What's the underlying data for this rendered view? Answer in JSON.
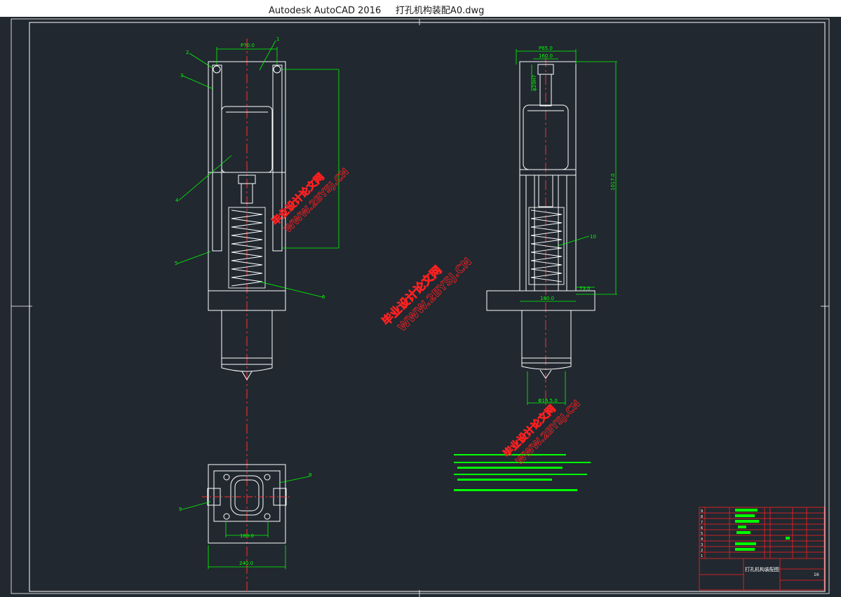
{
  "window": {
    "app_name": "Autodesk AutoCAD 2016",
    "file_name": "打孔机构装配A0.dwg"
  },
  "drawing": {
    "front_view": {
      "dim_top": "P70.0",
      "dim_bottom_plan": "240.0",
      "dim_plan_inner": "180.0",
      "leaders": [
        "1",
        "2",
        "3",
        "4",
        "5",
        "6",
        "8",
        "9"
      ]
    },
    "side_view": {
      "dim_top_outer": "P65.0",
      "dim_top_inner": "160.0",
      "dim_bore": "φ20H7",
      "dim_height": "1017.0",
      "dim_base_width": "180.0",
      "dim_flange": "73.0",
      "dim_shaft": "Φ16.5.0",
      "leader": "10"
    },
    "watermarks": [
      {
        "line1": "毕业设计论文网",
        "line2": "WWW.2BYSJ.CN"
      },
      {
        "line1": "毕业设计论文网",
        "line2": "WWW.2BYSJ.CN"
      },
      {
        "line1": "毕业设计论文网",
        "line2": "WWW.2BYSJ.CN"
      }
    ],
    "title_block": {
      "drawing_name": "打孔机构装配图",
      "part_rows": [
        "9",
        "8",
        "7",
        "6",
        "5",
        "4",
        "3",
        "2",
        "1"
      ],
      "sheet_number": "16"
    }
  },
  "colors": {
    "background": "#212830",
    "border": "#ffffff",
    "geometry": "#ffffff",
    "dimension": "#00ff00",
    "centerline": "#ff3030",
    "title_block": "#ff2020",
    "watermark": "#ff2020"
  }
}
